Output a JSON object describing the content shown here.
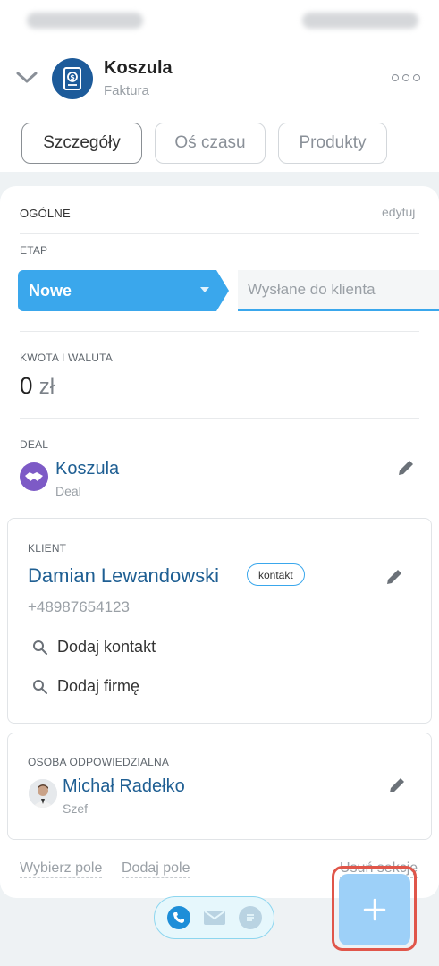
{
  "header": {
    "title": "Koszula",
    "subtitle": "Faktura"
  },
  "tabs": [
    {
      "label": "Szczegóły",
      "active": true
    },
    {
      "label": "Oś czasu",
      "active": false
    },
    {
      "label": "Produkty",
      "active": false
    }
  ],
  "general": {
    "label": "OGÓLNE",
    "edit_label": "edytuj"
  },
  "stage": {
    "label": "ETAP",
    "current": "Nowe",
    "next": "Wysłane do klienta",
    "accent_color": "#3aa7ec"
  },
  "amount": {
    "label": "KWOTA I WALUTA",
    "value": "0",
    "currency": "zł"
  },
  "deal": {
    "label": "DEAL",
    "name": "Koszula",
    "type": "Deal"
  },
  "client": {
    "label": "KLIENT",
    "name": "Damian Lewandowski",
    "badge": "kontakt",
    "phone": "+48987654123",
    "add_contact": "Dodaj kontakt",
    "add_company": "Dodaj firmę"
  },
  "responsible": {
    "label": "OSOBA ODPOWIEDZIALNA",
    "name": "Michał Radełko",
    "role": "Szef"
  },
  "footer": {
    "choose_field": "Wybierz pole",
    "add_field": "Dodaj pole",
    "remove_section": "Usuń sekcję"
  }
}
